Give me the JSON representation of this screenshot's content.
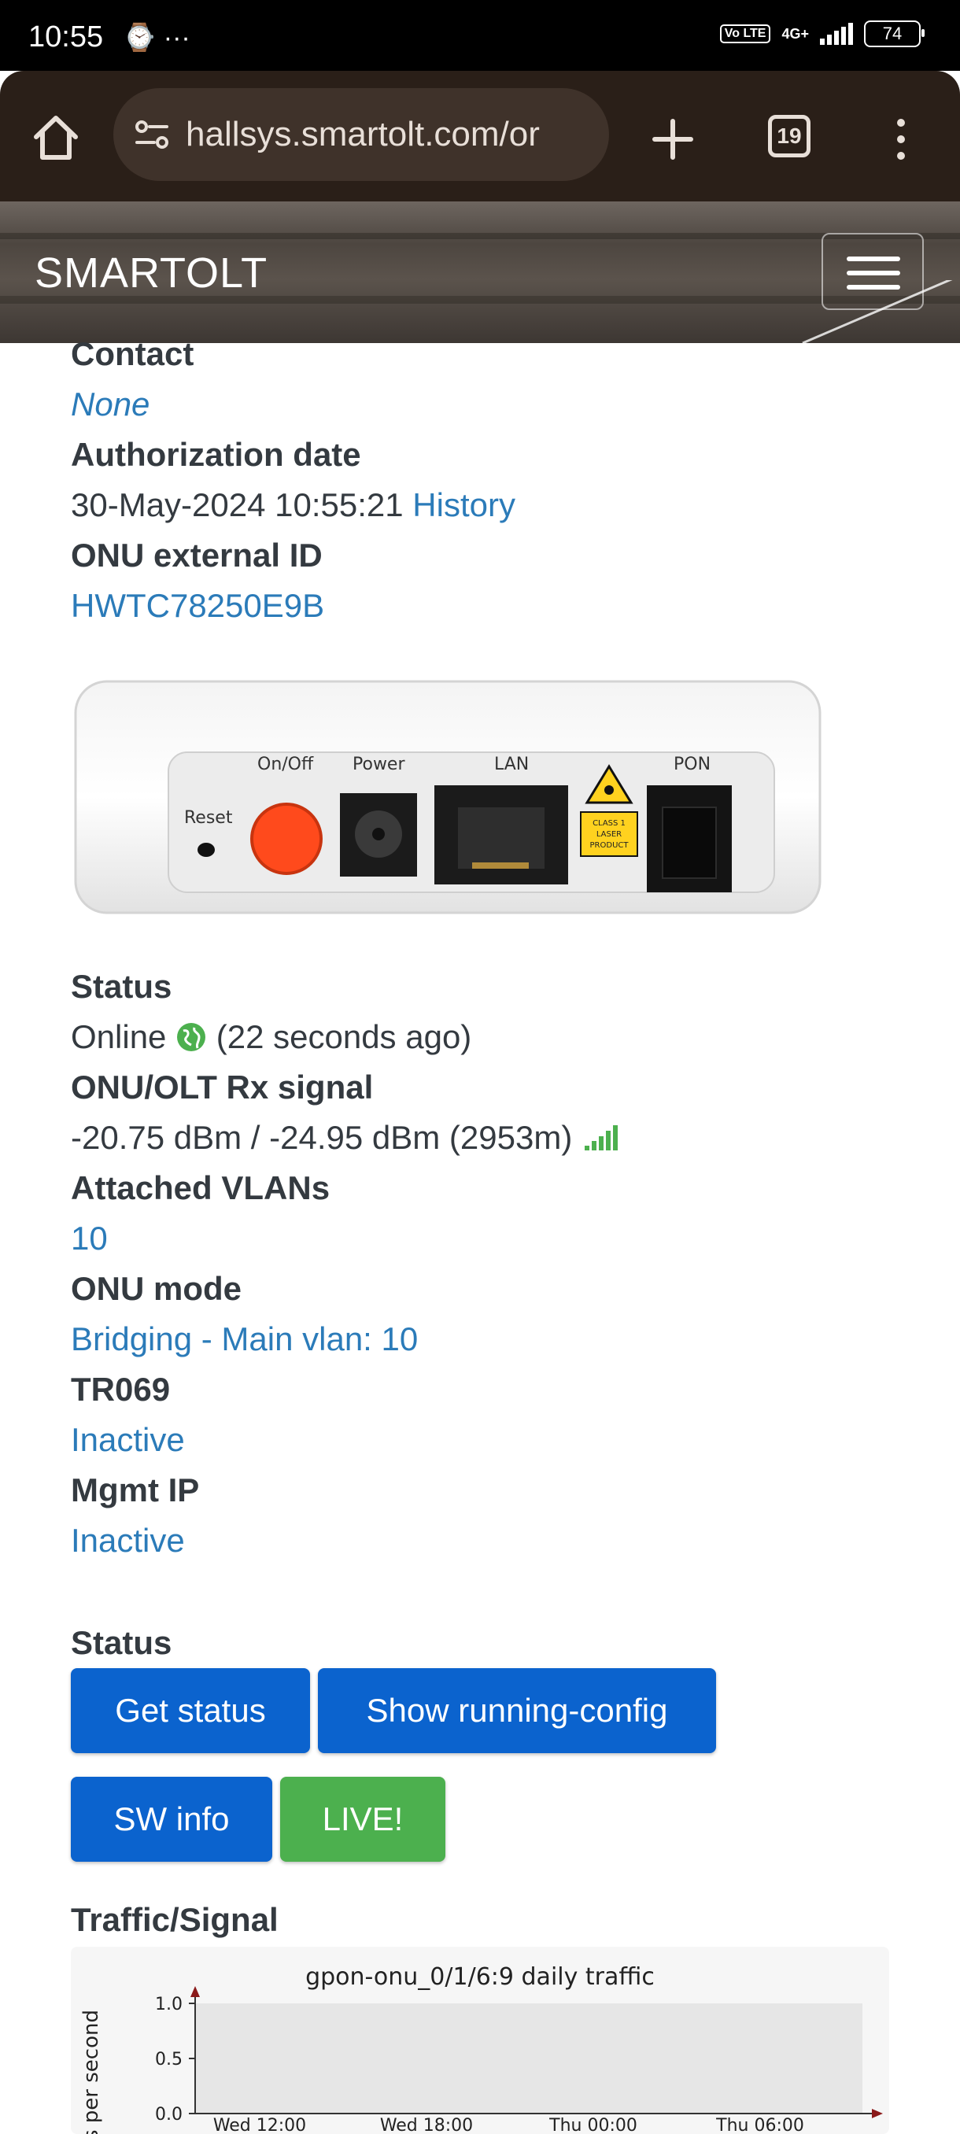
{
  "status_bar": {
    "time": "10:55",
    "left_icons": "⌚ ···",
    "volte": "Vo LTE",
    "network": "4G+",
    "battery": "74"
  },
  "browser": {
    "url": "hallsys.smartolt.com/or",
    "tab_count": "19"
  },
  "site": {
    "brand": "SMARTOLT"
  },
  "details": {
    "contact_label": "Contact",
    "contact_value": "None",
    "auth_date_label": "Authorization date",
    "auth_date_value": "30-May-2024 10:55:21",
    "history_link": "History",
    "ext_id_label": "ONU external ID",
    "ext_id_value": "HWTC78250E9B",
    "status_label": "Status",
    "status_value": "Online",
    "status_ago": "(22 seconds ago)",
    "signal_label": "ONU/OLT Rx signal",
    "signal_value": "-20.75 dBm / -24.95 dBm (2953m)",
    "vlans_label": "Attached VLANs",
    "vlans_value": "10",
    "mode_label": "ONU mode",
    "mode_value": "Bridging - Main vlan: 10",
    "tr069_label": "TR069",
    "tr069_value": "Inactive",
    "mgmt_label": "Mgmt IP",
    "mgmt_value": "Inactive"
  },
  "device_image": {
    "onoff": "On/Off",
    "power": "Power",
    "lan": "LAN",
    "pon": "PON",
    "reset": "Reset",
    "laser_line1": "CLASS 1",
    "laser_line2": "LASER",
    "laser_line3": "PRODUCT"
  },
  "actions": {
    "section_label": "Status",
    "get_status": "Get status",
    "running_config": "Show running-config",
    "sw_info": "SW info",
    "live": "LIVE!"
  },
  "traffic": {
    "section_label": "Traffic/Signal"
  },
  "colors": {
    "link": "#2b7bb9",
    "button_blue": "#0b63ce",
    "button_green": "#4cb04e",
    "online_icon": "#4cb04e"
  },
  "chart_data": {
    "type": "line",
    "title": "gpon-onu_0/1/6:9 daily traffic",
    "ylabel": "bits per second",
    "xlabel": "",
    "yticks": [
      "1.0",
      "0.5",
      "0.0"
    ],
    "xticks": [
      "Wed 12:00",
      "Wed 18:00",
      "Thu 00:00",
      "Thu 06:00"
    ],
    "ylim": [
      0,
      1.0
    ],
    "series": [],
    "grid": false
  }
}
